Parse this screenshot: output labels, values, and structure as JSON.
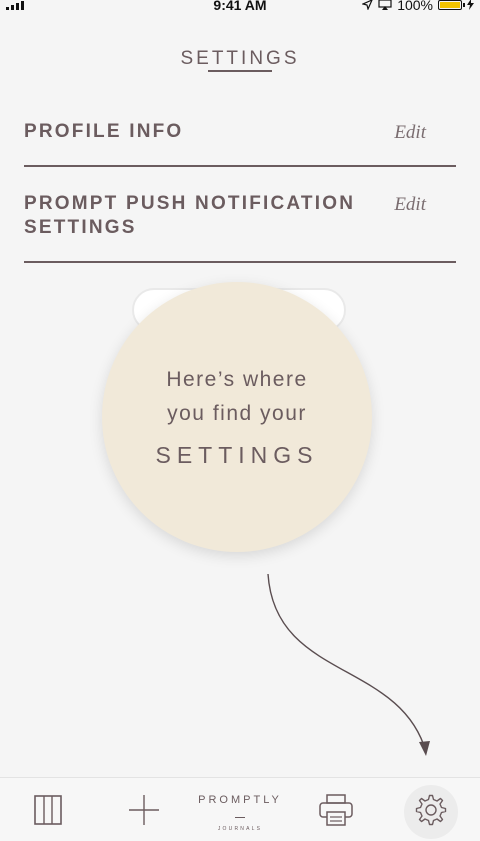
{
  "status_bar": {
    "time": "9:41 AM",
    "battery_percent": "100%",
    "battery_color": "#f3c400"
  },
  "header": {
    "title": "SETTINGS"
  },
  "rows": [
    {
      "label": "PROFILE INFO",
      "action": "Edit"
    },
    {
      "label": "PROMPT PUSH NOTIFICATION SETTINGS",
      "action": "Edit"
    }
  ],
  "tooltip": {
    "line1": "Here’s where",
    "line2": "you find your",
    "line3": "SETTINGS",
    "bg_color": "#f1e9d9"
  },
  "tab_bar": {
    "brand_name": "PROMPTLY",
    "brand_subtitle": "JOURNALS",
    "icons": [
      "journals-grid-icon",
      "add-icon",
      "print-icon",
      "gear-icon"
    ]
  },
  "colors": {
    "text": "#6b5c5f",
    "background": "#f5f5f5"
  }
}
